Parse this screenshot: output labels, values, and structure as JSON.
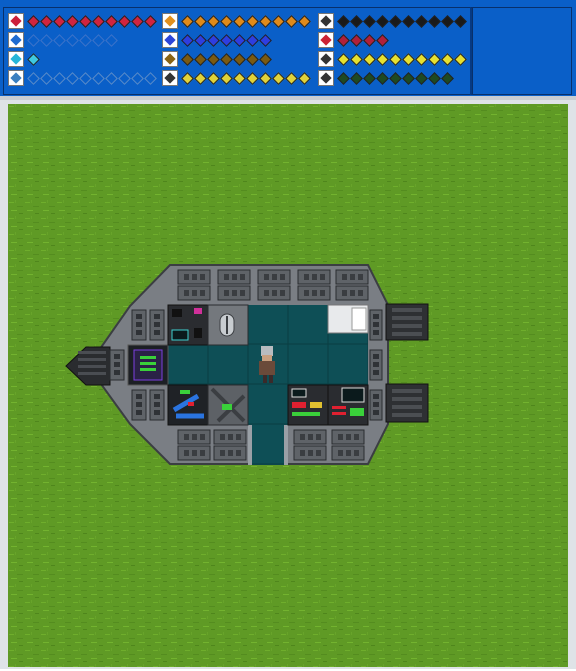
{
  "hud": {
    "columns": [
      [
        {
          "id": "health",
          "icon": "health-heart-icon",
          "icon_color": "#cc1f3a",
          "pips": 10,
          "filled": 10,
          "pip_color": "#d0243f"
        },
        {
          "id": "armor",
          "icon": "armor-shield-icon",
          "icon_color": "#1d6ad0",
          "pips": 7,
          "filled": 0,
          "pip_color": "#3d73c9"
        },
        {
          "id": "shield",
          "icon": "shield-gem-icon",
          "icon_color": "#27b6d8",
          "pips": 1,
          "filled": 1,
          "pip_color": "#3fc9e0"
        },
        {
          "id": "oxygen",
          "icon": "oxygen-o2-icon",
          "icon_color": "#3a7fc0",
          "pips": 10,
          "filled": 0,
          "pip_color": "#5a8bc8"
        }
      ],
      [
        {
          "id": "energy",
          "icon": "energy-bolt-icon",
          "icon_color": "#e2901c",
          "pips": 10,
          "filled": 10,
          "pip_color": "#e08a1a"
        },
        {
          "id": "water",
          "icon": "water-drop-icon",
          "icon_color": "#2e46d8",
          "pips": 7,
          "filled": 7,
          "pip_color": "#2e3ee0"
        },
        {
          "id": "food",
          "icon": "food-bread-icon",
          "icon_color": "#8a6414",
          "pips": 7,
          "filled": 7,
          "pip_color": "#7a5a12"
        },
        {
          "id": "sleep",
          "icon": "sleep-zz-icon",
          "icon_color": "#333333",
          "pips": 10,
          "filled": 10,
          "pip_color": "#e0d23a"
        }
      ],
      [
        {
          "id": "money",
          "icon": "money-bag-icon",
          "icon_color": "#333333",
          "pips": 10,
          "filled": 10,
          "pip_color": "#1a1a1a"
        },
        {
          "id": "bio-hazard",
          "icon": "biohazard-icon",
          "icon_color": "#cc2233",
          "pips": 4,
          "filled": 4,
          "pip_color": "#b0203a"
        },
        {
          "id": "radiation",
          "icon": "radiation-icon",
          "icon_color": "#333333",
          "pips": 10,
          "filled": 10,
          "pip_color": "#e6e030"
        },
        {
          "id": "weapon",
          "icon": "pistol-icon",
          "icon_color": "#333333",
          "pips": 9,
          "filled": 9,
          "pip_color": "#1e4a22"
        }
      ]
    ]
  },
  "colors": {
    "grass": "#5f9a25",
    "hull": "#7a7e84",
    "hull_dark": "#45484d",
    "floor": "#0e4f56",
    "hud_bg": "#0a5fc8"
  }
}
